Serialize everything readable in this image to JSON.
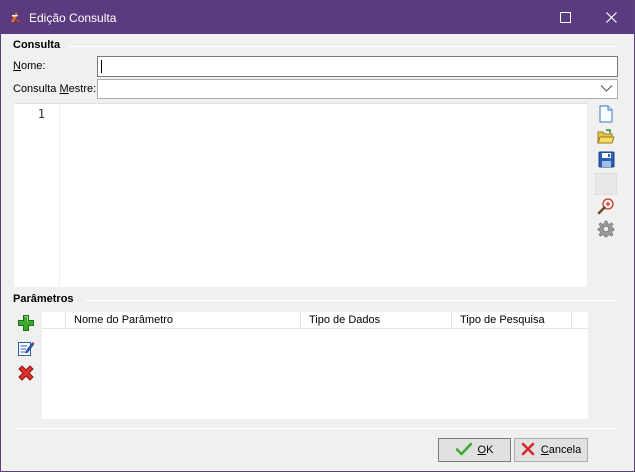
{
  "window": {
    "title": "Edição Consulta",
    "title_color": "#5b3b80",
    "icons": {
      "app": "app-logo-icon",
      "maximize": "maximize-icon",
      "close": "close-icon"
    }
  },
  "consulta": {
    "section_title": "Consulta",
    "nome_label_underlined": "N",
    "nome_label_rest": "ome:",
    "nome_value": "",
    "mestre_label_pre": "Consulta ",
    "mestre_label_underlined": "M",
    "mestre_label_rest": "estre:",
    "mestre_value": ""
  },
  "editor": {
    "line_numbers": [
      "1"
    ],
    "content": "",
    "toolbar_icons": [
      "new-document-icon",
      "open-folder-icon",
      "save-disk-icon",
      "blank-button",
      "zoom-search-icon",
      "gear-icon"
    ]
  },
  "parametros": {
    "section_title": "Parâmetros",
    "columns": [
      "Nome do Parâmetro",
      "Tipo de Dados",
      "Tipo de Pesquisa"
    ],
    "rows": [],
    "side_icons": [
      "add-icon",
      "edit-icon",
      "delete-icon"
    ]
  },
  "buttons": {
    "ok_underlined": "O",
    "ok_rest": "K",
    "cancel_underlined": "C",
    "cancel_rest": "ancela"
  }
}
